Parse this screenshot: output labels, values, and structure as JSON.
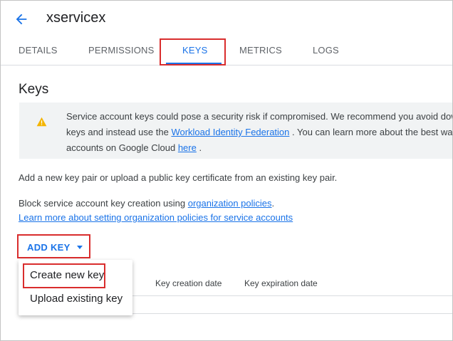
{
  "header": {
    "title": "xservicex",
    "back_icon": "arrow-back-icon"
  },
  "tabs": [
    {
      "label": "DETAILS",
      "active": false
    },
    {
      "label": "PERMISSIONS",
      "active": false
    },
    {
      "label": "KEYS",
      "active": true
    },
    {
      "label": "METRICS",
      "active": false
    },
    {
      "label": "LOGS",
      "active": false
    }
  ],
  "page": {
    "title": "Keys"
  },
  "warning": {
    "icon": "warning-icon",
    "line1": "Service account keys could pose a security risk if compromised. We recommend you avoid dow",
    "line2_prefix": "keys and instead use the ",
    "line2_link": "Workload Identity Federation",
    "line2_suffix": " . You can learn more about the best way",
    "line3_prefix": "accounts on Google Cloud ",
    "line3_link": "here",
    "line3_suffix": " ."
  },
  "description": "Add a new key pair or upload a public key certificate from an existing key pair.",
  "policy": {
    "prefix": "Block service account key creation using ",
    "link": "organization policies",
    "suffix": ".",
    "learn_more_link": "Learn more about setting organization policies for service accounts"
  },
  "add_key": {
    "label": "ADD KEY",
    "icon": "caret-down-icon"
  },
  "table": {
    "columns": [
      "Key creation date",
      "Key expiration date"
    ]
  },
  "menu": {
    "items": [
      "Create new key",
      "Upload existing key"
    ]
  },
  "colors": {
    "accent": "#1a73e8",
    "highlight": "#d92d2d",
    "warning": "#f4b400",
    "banner_bg": "#f1f3f4"
  }
}
